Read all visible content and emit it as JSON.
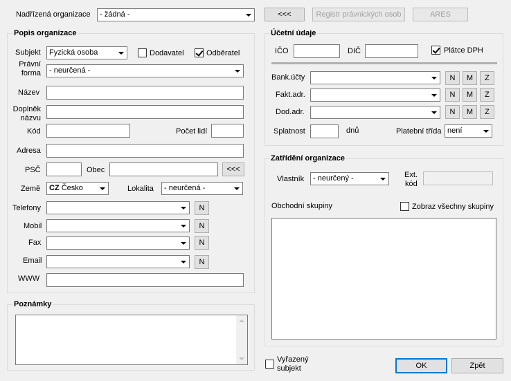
{
  "top": {
    "parent_org_label": "Nadřízená organizace",
    "parent_org_value": "- žádná -",
    "back_button": "<<<",
    "registry_button": "Registr právnických osob",
    "ares_button": "ARES"
  },
  "popis": {
    "title": "Popis organizace",
    "subjekt_label": "Subjekt",
    "subjekt_value": "Fyzická osoba",
    "dodavatel_label": "Dodavatel",
    "dodavatel_checked": false,
    "odberatel_label": "Odběratel",
    "odberatel_checked": true,
    "pravni_forma_label_1": "Právní",
    "pravni_forma_label_2": "forma",
    "pravni_forma_value": "- neurčená -",
    "nazev_label": "Název",
    "doplnek_label_1": "Doplněk",
    "doplnek_label_2": "názvu",
    "kod_label": "Kód",
    "pocet_lidi_label": "Počet lidí",
    "adresa_label": "Adresa",
    "psc_label": "PSČ",
    "obec_label": "Obec",
    "obec_button": "<<<",
    "zeme_label": "Země",
    "zeme_code": "CZ",
    "zeme_value": "Česko",
    "lokalita_label": "Lokalita",
    "lokalita_value": "- neurčená -",
    "telefony_label": "Telefony",
    "mobil_label": "Mobil",
    "fax_label": "Fax",
    "email_label": "Email",
    "www_label": "WWW",
    "new_button": "N"
  },
  "poznamky": {
    "title": "Poznámky"
  },
  "ucetni": {
    "title": "Účetní údaje",
    "ico_label": "IČO",
    "dic_label": "DIČ",
    "platce_dph_label": "Plátce DPH",
    "platce_dph_checked": true,
    "bank_label": "Bank.účty",
    "fakt_label": "Fakt.adr.",
    "dod_label": "Dod.adr.",
    "btn_n": "N",
    "btn_m": "M",
    "btn_z": "Z",
    "splatnost_label": "Splatnost",
    "dnu_label": "dnů",
    "platebni_trida_label": "Platební třída",
    "platebni_trida_value": "není"
  },
  "zatrideni": {
    "title": "Zatřídění organizace",
    "vlastnik_label": "Vlastník",
    "vlastnik_value": "- neurčený -",
    "ext_kod_label_1": "Ext.",
    "ext_kod_label_2": "kód",
    "obchodni_skupiny_label": "Obchodní skupiny",
    "zobraz_label": "Zobraz všechny skupiny",
    "zobraz_checked": false
  },
  "bottom": {
    "vyrazeny_label_1": "Vyřazený",
    "vyrazeny_label_2": "subjekt",
    "vyrazeny_checked": false,
    "ok_button": "OK",
    "zpet_button": "Zpět"
  }
}
